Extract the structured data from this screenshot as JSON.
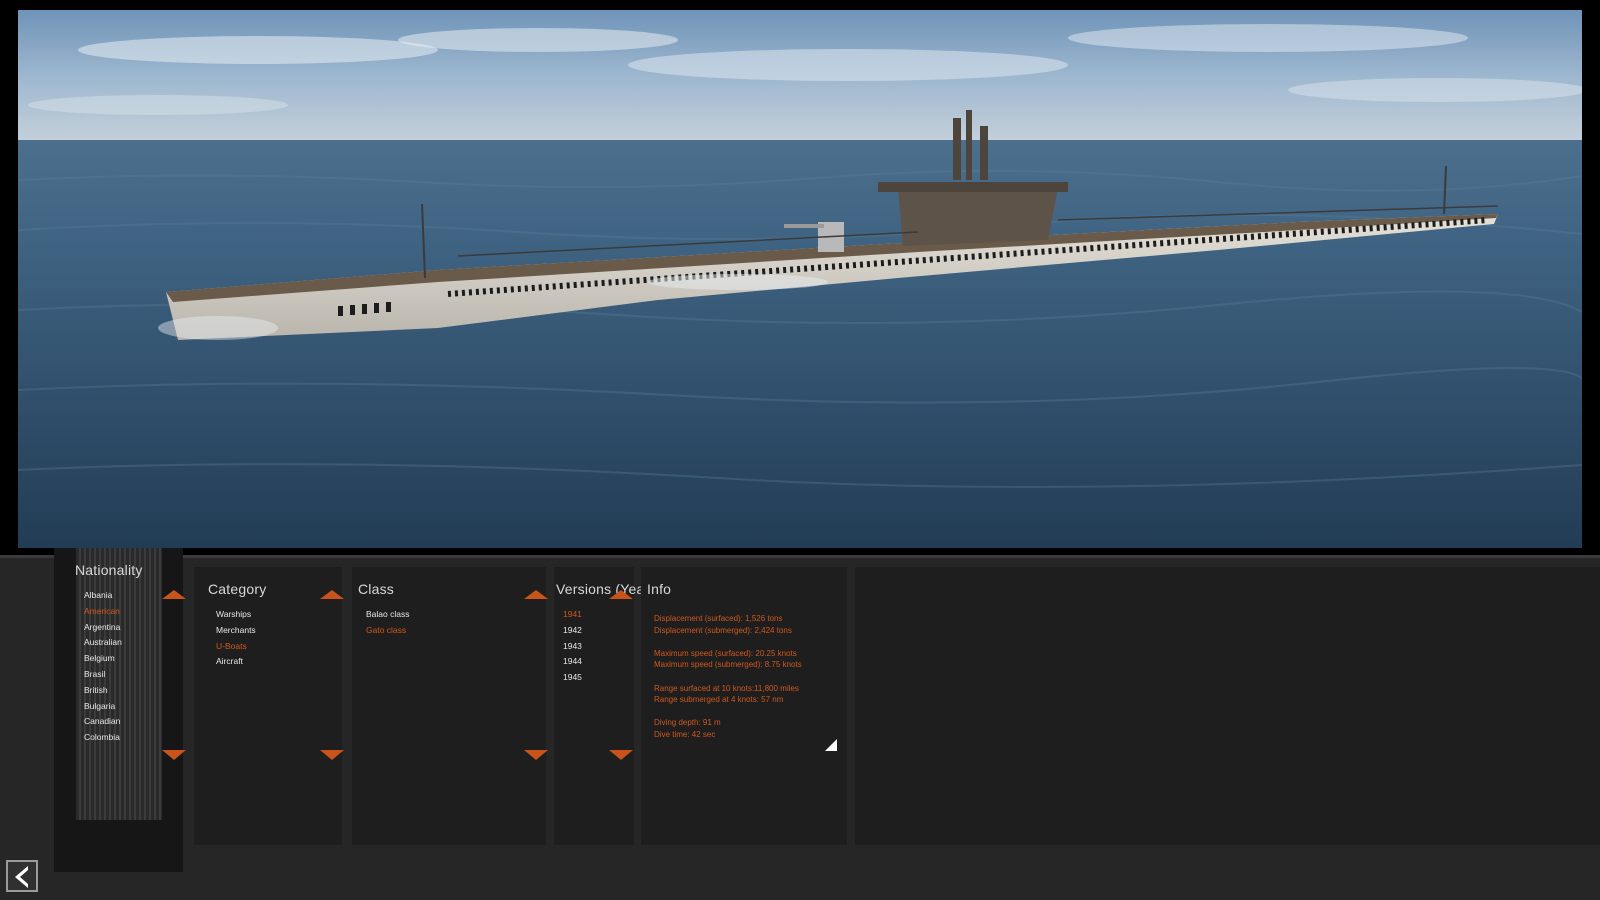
{
  "nationality": {
    "title": "Nationality",
    "items": [
      "Albania",
      "American",
      "Argentina",
      "Australian",
      "Belgium",
      "Brasil",
      "British",
      "Bulgaria",
      "Canadian",
      "Colombia"
    ],
    "selected_index": 1
  },
  "category": {
    "title": "Category",
    "items": [
      "Warships",
      "Merchants",
      "U-Boats",
      "Aircraft"
    ],
    "selected_index": 2
  },
  "class": {
    "title": "Class",
    "items": [
      "Balao class",
      "Gato class"
    ],
    "selected_index": 1
  },
  "versions": {
    "title": "Versions (Year)",
    "items": [
      "1941",
      "1942",
      "1943",
      "1944",
      "1945"
    ],
    "selected_index": 0
  },
  "info": {
    "title": "Info",
    "lines": [
      "Displacement (surfaced): 1,526 tons",
      "Displacement (submerged): 2,424 tons",
      "",
      "Maximum speed (surfaced): 20.25 knots",
      "Maximum speed (submerged): 8.75 knots",
      "",
      "Range surfaced at 10 knots:11,800 miles",
      "Range submerged at 4 knots: 57 nm",
      "",
      "Diving depth: 91 m",
      "Dive time: 42 sec"
    ]
  },
  "colors": {
    "accent": "#d0581f",
    "panel": "#1e1e1e",
    "background": "#262626"
  },
  "icons": {
    "back": "back-arrow-icon",
    "scroll_up": "triangle-up-icon",
    "scroll_down": "triangle-down-icon"
  }
}
